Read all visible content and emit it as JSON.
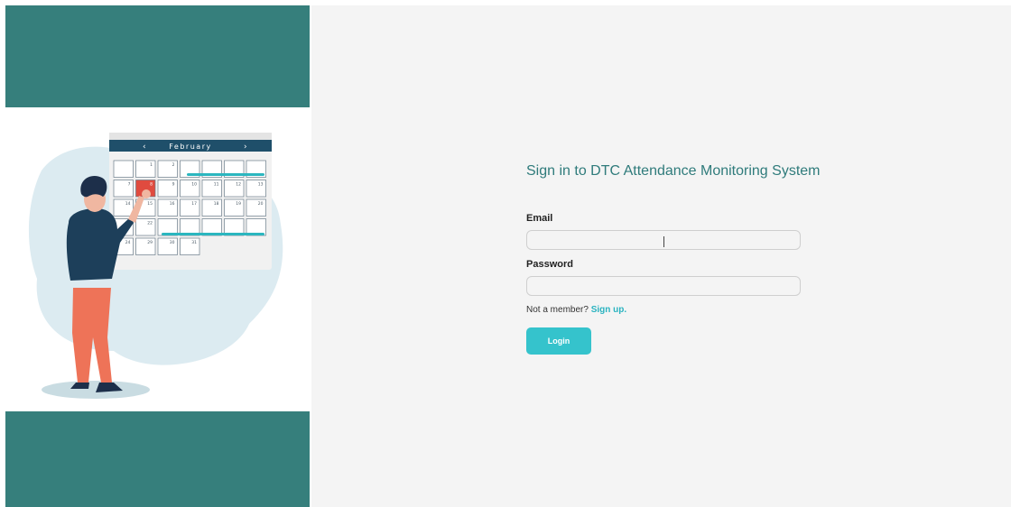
{
  "illustration": {
    "calendar_month": "February",
    "prev_arrow": "‹",
    "next_arrow": "›",
    "days": [
      "1",
      "2",
      "7",
      "8",
      "9",
      "10",
      "11",
      "12",
      "13",
      "14",
      "15",
      "16",
      "17",
      "18",
      "19",
      "20",
      "22",
      "24",
      "29",
      "30",
      "31"
    ]
  },
  "login": {
    "title": "Sign in to DTC Attendance Monitoring System",
    "email_label": "Email",
    "email_value": "",
    "password_label": "Password",
    "password_value": "",
    "not_member_text": "Not a member?",
    "signup_link": "Sign up.",
    "login_button": "Login"
  },
  "colors": {
    "teal_band": "#367f7c",
    "title_color": "#2f7b7b",
    "accent_cyan": "#35c3cc",
    "calendar_header": "#1f4f6a",
    "highlight_red": "#e04b3f"
  }
}
